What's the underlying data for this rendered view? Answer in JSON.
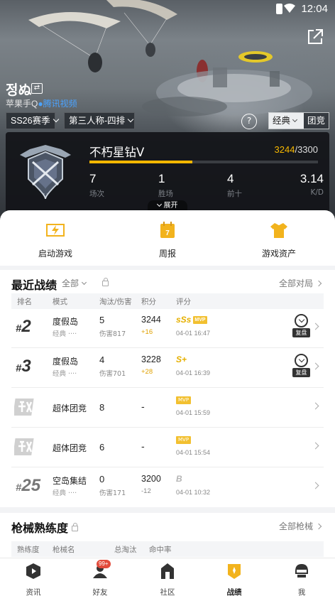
{
  "status_bar": {
    "time": "12:04"
  },
  "player": {
    "name": "정ぬ",
    "platform": "苹果手Q",
    "tag": "腾讯视频"
  },
  "filters": {
    "season": "SS26赛季",
    "mode": "第三人称-四排",
    "help": "?",
    "seg_selected": "经典",
    "seg_other": "团竞"
  },
  "rank": {
    "tier": "不朽星钻V",
    "points_current": "3244",
    "points_total": "/3300",
    "progress": 0.45,
    "stats": [
      {
        "value": "7",
        "label": "场次"
      },
      {
        "value": "1",
        "label": "胜场"
      },
      {
        "value": "4",
        "label": "前十"
      },
      {
        "value": "3.14",
        "label": "K/D"
      }
    ],
    "expand": "展开"
  },
  "quick_actions": [
    {
      "label": "启动游戏",
      "icon": "lightning-icon"
    },
    {
      "label": "周报",
      "icon": "calendar-icon"
    },
    {
      "label": "游戏资产",
      "icon": "shirt-icon"
    }
  ],
  "matches": {
    "title": "最近战绩",
    "filter": "全部",
    "more": "全部对局",
    "headers": [
      "排名",
      "模式",
      "淘汰/伤害",
      "积分",
      "评分"
    ],
    "rows": [
      {
        "rank_hash": "#",
        "rank": "2",
        "mode": "度假岛",
        "mode_sub": "经典 ····",
        "kills": "5",
        "damage": "伤害817",
        "score": "3244",
        "delta": "+16",
        "grade": "sSs",
        "mvp": "MVP",
        "time": "04-01 16:47",
        "replay": "复盘"
      },
      {
        "rank_hash": "#",
        "rank": "3",
        "mode": "度假岛",
        "mode_sub": "经典 ····",
        "kills": "4",
        "damage": "伤害701",
        "score": "3228",
        "delta": "+28",
        "grade": "S+",
        "time": "04-01 16:39",
        "replay": "复盘"
      },
      {
        "mode": "超体团竞",
        "kills": "8",
        "score": "-",
        "mvp": "MVP",
        "time": "04-01 15:59"
      },
      {
        "mode": "超体团竞",
        "kills": "6",
        "score": "-",
        "mvp": "MVP",
        "time": "04-01 15:54"
      },
      {
        "rank_hash": "#",
        "rank": "25",
        "mode": "空岛集结",
        "mode_sub": "经典 ····",
        "kills": "0",
        "damage": "伤害171",
        "score": "3200",
        "delta": "-12",
        "grade": "B",
        "time": "04-01 10:32"
      }
    ]
  },
  "weapons": {
    "title": "枪械熟练度",
    "more": "全部枪械",
    "headers": [
      "熟练度",
      "枪械名",
      "总淘汰",
      "命中率"
    ]
  },
  "nav": [
    {
      "label": "资讯",
      "icon": "news-play-icon"
    },
    {
      "label": "好友",
      "icon": "friends-icon",
      "badge": "99+"
    },
    {
      "label": "社区",
      "icon": "community-icon"
    },
    {
      "label": "战绩",
      "icon": "record-icon",
      "active": true
    },
    {
      "label": "我",
      "icon": "profile-icon"
    }
  ],
  "colors": {
    "accent": "#f5b700",
    "link": "#4aa3ff",
    "badge": "#e24b3b"
  }
}
